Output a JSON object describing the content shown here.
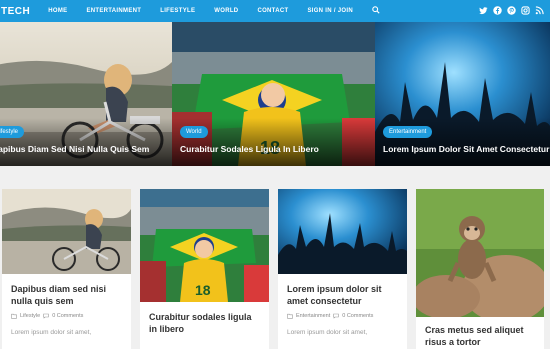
{
  "nav": {
    "logo": "TECH",
    "items": [
      "HOME",
      "ENTERTAINMENT",
      "LIFESTYLE",
      "WORLD",
      "CONTACT",
      "SIGN IN / JOIN"
    ],
    "social_icons": [
      "twitter-icon",
      "facebook-icon",
      "pinterest-icon",
      "instagram-icon",
      "rss-icon"
    ]
  },
  "slider": [
    {
      "category": "Lifestyle",
      "title": "Dapibus Diam Sed Nisi Nulla Quis Sem"
    },
    {
      "category": "World",
      "title": "Curabitur Sodales Ligula In Libero"
    },
    {
      "category": "Entertainment",
      "title": "Lorem Ipsum Dolor Sit Amet Consectetur"
    }
  ],
  "cards": [
    {
      "title": "Dapibus diam sed nisi nulla quis sem",
      "category": "Lifestyle",
      "comments": "0 Comments",
      "excerpt": "Lorem ipsum dolor sit amet,"
    },
    {
      "title": "Curabitur sodales ligula in libero",
      "category": "World",
      "comments": "0 Comments",
      "excerpt": "Lorem ipsum dolor sit amet,"
    },
    {
      "title": "Lorem ipsum dolor sit amet consectetur",
      "category": "Entertainment",
      "comments": "0 Comments",
      "excerpt": "Lorem ipsum dolor sit amet,"
    },
    {
      "title": "Cras metus sed aliquet risus a tortor",
      "category": "",
      "comments": "",
      "excerpt": ""
    }
  ],
  "colors": {
    "accent": "#1e9bdc"
  }
}
